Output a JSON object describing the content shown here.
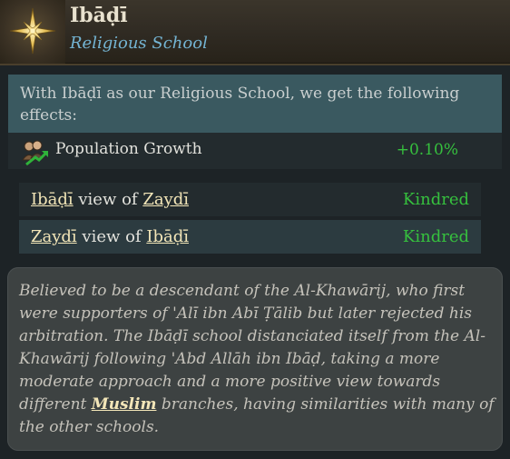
{
  "header": {
    "icon": "compass-star-icon",
    "title": "Ibāḍī",
    "subtitle": "Religious School"
  },
  "effects": {
    "intro": "With Ibāḍī as our Religious School, we get the following effects:",
    "items": [
      {
        "icon": "population-growth-icon",
        "name": "Population Growth",
        "value": "+0.10%"
      }
    ]
  },
  "views": [
    {
      "subject": "Ibāḍī",
      "connector": " view of ",
      "object": "Zaydī",
      "relation": "Kindred"
    },
    {
      "subject": "Zaydī",
      "connector": " view of ",
      "object": "Ibāḍī",
      "relation": "Kindred"
    }
  ],
  "description": {
    "before": "Believed to be a descendant of the Al-Khawārij, who first were supporters of 'Alī ibn Abī Ṭālib but later rejected his arbitration. The Ibāḍī school distanciated itself from the Al-Khawārij following 'Abd Allāh ibn Ibāḍ, taking a more moderate approach and a more positive view towards different ",
    "link": "Muslim",
    "after": " branches, having similarities with many of the other schools."
  },
  "colors": {
    "positive": "#36c03e",
    "subtitle": "#74b4d3",
    "link": "#f3e6b8"
  }
}
